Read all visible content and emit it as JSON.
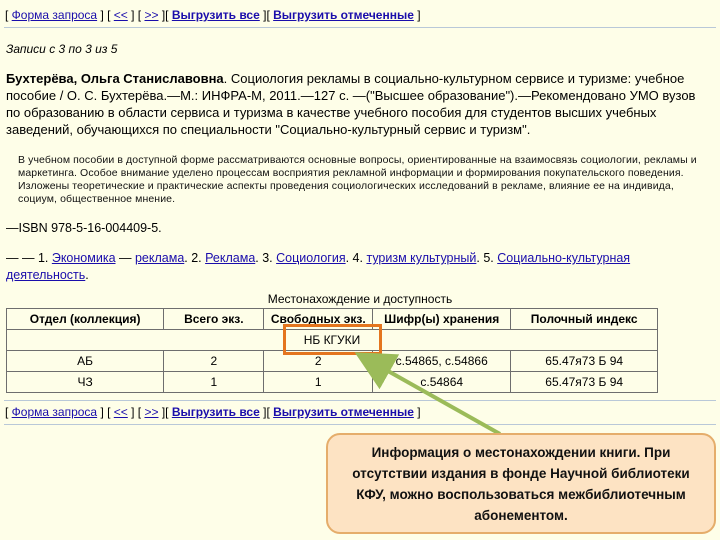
{
  "nav_top": {
    "query_form": "Форма запроса",
    "prev": "<<",
    "next": ">>",
    "export_all": "Выгрузить все",
    "export_marked": "Выгрузить отмеченные"
  },
  "nav_bottom": {
    "query_form": "Форма запроса",
    "prev": "<<",
    "next": ">>",
    "export_all": "Выгрузить все",
    "export_marked": "Выгрузить отмеченные"
  },
  "records_info": "Записи с 3 по 3 из 5",
  "record": {
    "author": "Бухтерёва, Ольга Станиславовна",
    "description": ". Социология рекламы в социально-культурном сервисе и туризме: учебное пособие / О. С. Бухтерёва.—М.: ИНФРА-М, 2011.—127 с. —(\"Высшее образование\").—Рекомендовано УМО вузов по образованию в области сервиса и туризма в качестве учебного пособия для студентов высших учебных заведений, обучающихся по специальности \"Социально-культурный сервис и туризм\".",
    "abstract": "В учебном пособии в доступной форме рассматриваются основные вопросы, ориентированные на взаимосвязь социологии, рекламы и маркетинга. Особое внимание уделено процессам восприятия рекламной информации и формирования покупательского поведения. Изложены теоретические и практические аспекты проведения социологических исследований в рекламе, влияние ее на индивида, социум, общественное мнение.",
    "isbn": "—ISBN 978-5-16-004409-5.",
    "subjects_prefix": "— — 1. ",
    "subj1": "Экономика",
    "sep1": " — ",
    "subj2": "реклама",
    "sep2": ". 2. ",
    "subj3": "Реклама",
    "sep3": ". 3. ",
    "subj4": "Социология",
    "sep4": ". 4. ",
    "subj5": "туризм культурный",
    "sep5": ". 5. ",
    "subj6": "Социально-культурная деятельность",
    "suffix": "."
  },
  "table": {
    "caption": "Местонахождение и доступность",
    "headers": [
      "Отдел (коллекция)",
      "Всего экз.",
      "Свободных экз.",
      "Шифр(ы) хранения",
      "Полочный индекс"
    ],
    "group_label": "НБ КГУКИ",
    "rows": [
      [
        "АБ",
        "2",
        "2",
        "с.54865, с.54866",
        "65.47я73 Б 94"
      ],
      [
        "ЧЗ",
        "1",
        "1",
        "с.54864",
        "65.47я73 Б 94"
      ]
    ]
  },
  "callout": {
    "text": "Информация о местонахождении книги. При отсутствии издания в фонде Научной библиотеки КФУ, можно воспользоваться межбиблиотечным абонементом."
  },
  "colors": {
    "page_bg": "#fefee8",
    "link": "#1a0dab",
    "highlight_border": "#e4751e",
    "callout_bg": "#fde3c3",
    "arrow": "#9bbb59"
  }
}
